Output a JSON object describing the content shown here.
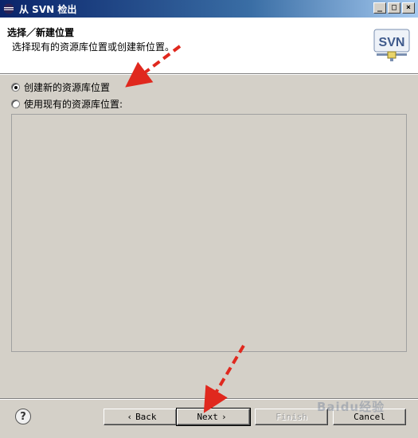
{
  "window": {
    "title": "从 SVN 检出",
    "controls": {
      "minimize": "_",
      "maximize": "□",
      "close": "×"
    }
  },
  "header": {
    "title": "选择／新建位置",
    "description": "选择现有的资源库位置或创建新位置。",
    "logo_text": "SVN"
  },
  "options": [
    {
      "label": "创建新的资源库位置",
      "selected": true
    },
    {
      "label": "使用现有的资源库位置:",
      "selected": false
    }
  ],
  "buttons": {
    "help": "?",
    "back": "Back",
    "next": "Next",
    "finish": "Finish",
    "cancel": "Cancel"
  },
  "watermark": "Baidu经验",
  "colors": {
    "annotation_arrow": "#e0281e",
    "titlebar_start": "#0a246a",
    "titlebar_end": "#a6caf0",
    "dialog_bg": "#d4d0c8"
  },
  "icons": {
    "app": "eclipse-icon",
    "logo": "svn-logo-icon",
    "help": "help-icon",
    "back": "chevron-left-icon",
    "next": "chevron-right-icon"
  }
}
